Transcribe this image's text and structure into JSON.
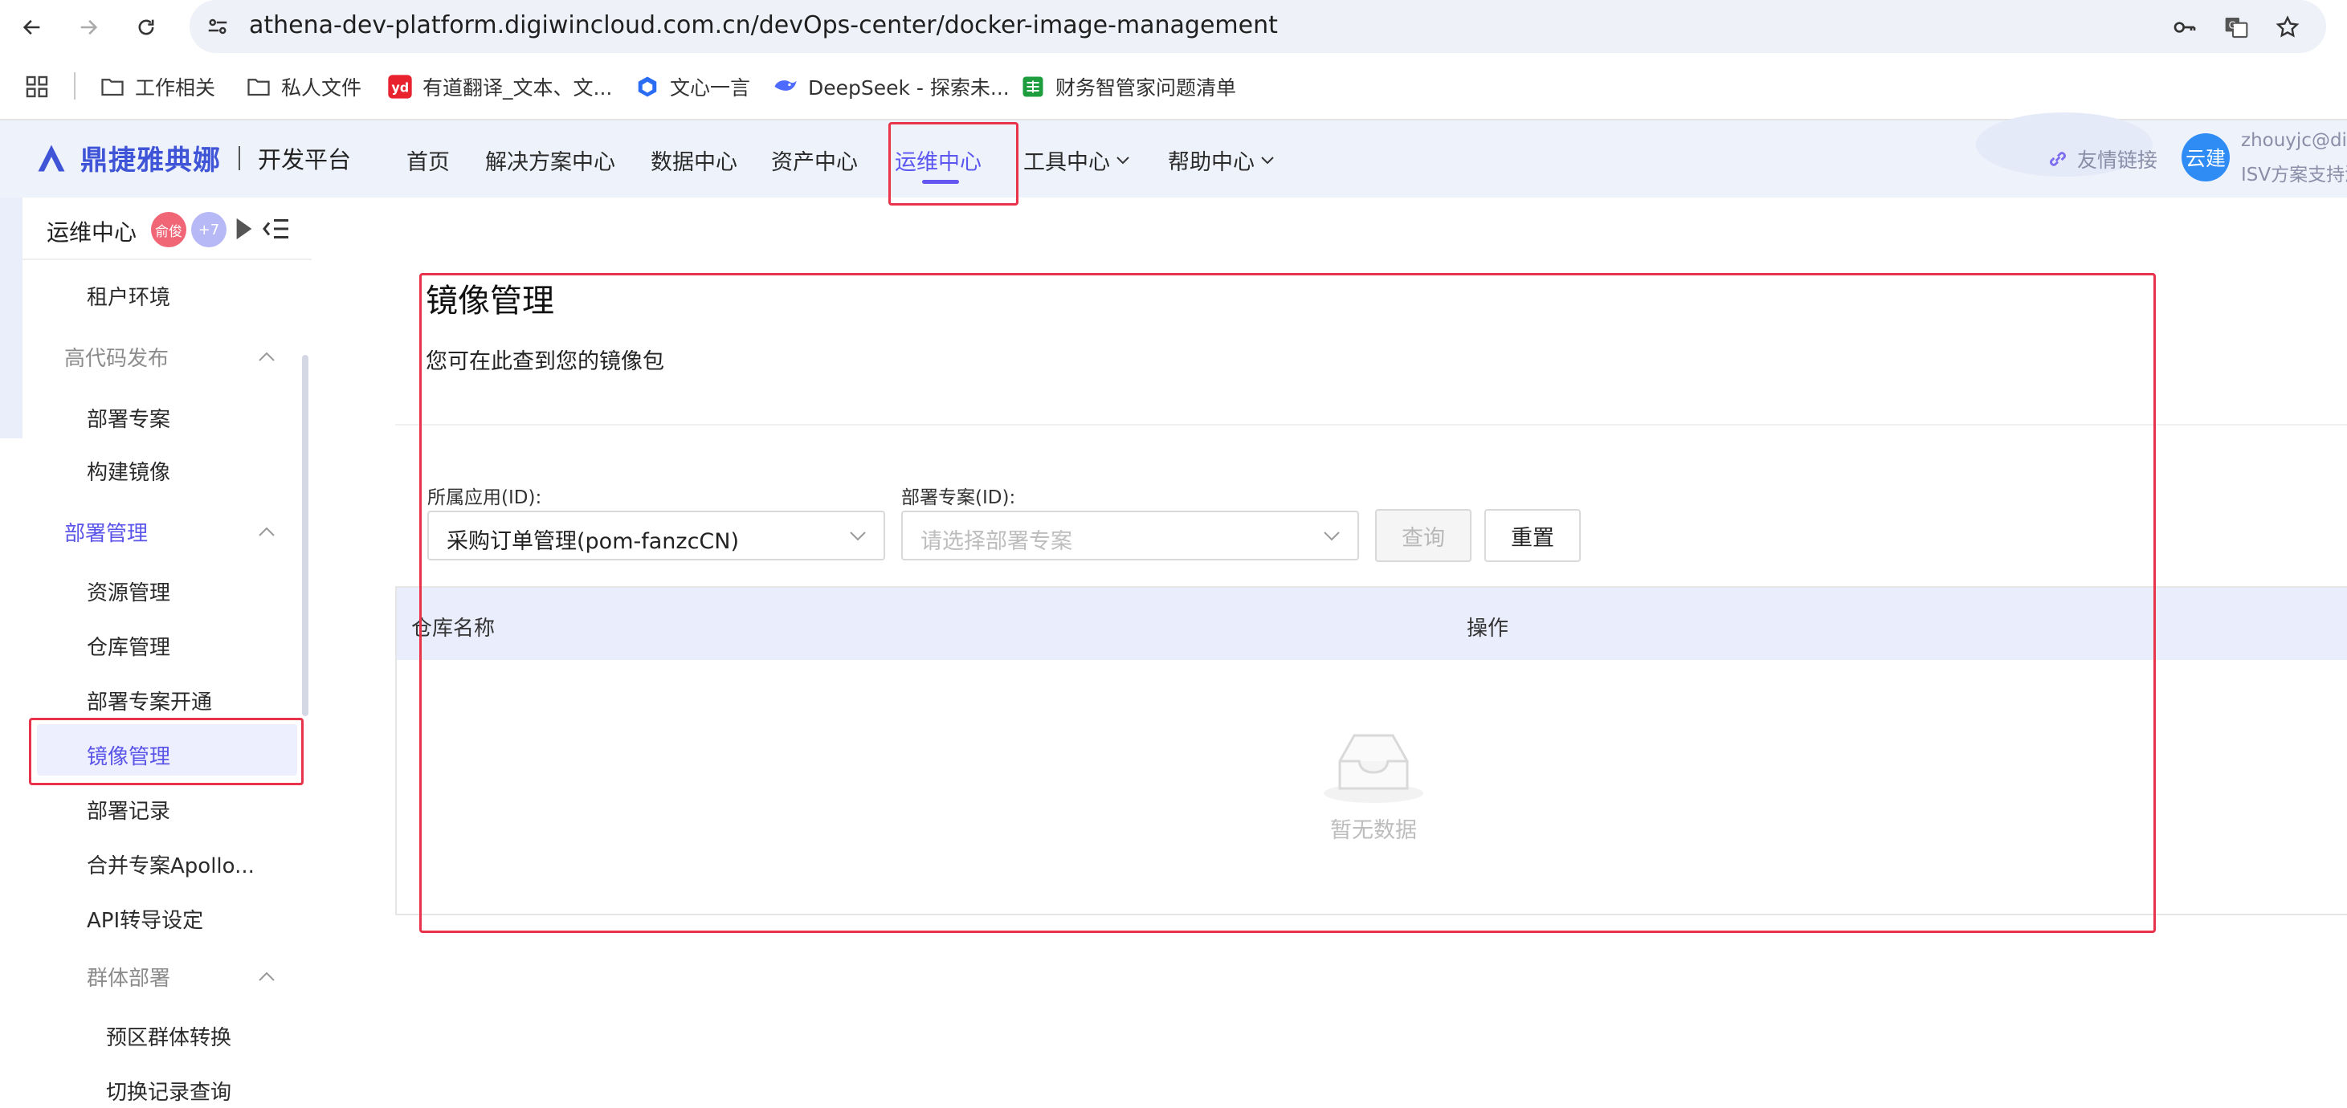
{
  "browser": {
    "url": "athena-dev-platform.digiwincloud.com.cn/devOps-center/docker-image-management",
    "bookmarks": [
      {
        "label": "工作相关",
        "icon": "folder-icon"
      },
      {
        "label": "私人文件",
        "icon": "folder-icon"
      },
      {
        "label": "有道翻译_文本、文...",
        "icon": "youdao-icon"
      },
      {
        "label": "文心一言",
        "icon": "wenxin-icon"
      },
      {
        "label": "DeepSeek - 探索未...",
        "icon": "deepseek-icon"
      },
      {
        "label": "财务智管家问题清单",
        "icon": "sheet-icon"
      }
    ]
  },
  "header": {
    "brand": "鼎捷雅典娜",
    "subtitle": "开发平台",
    "nav": [
      {
        "label": "首页"
      },
      {
        "label": "解决方案中心"
      },
      {
        "label": "数据中心"
      },
      {
        "label": "资产中心"
      },
      {
        "label": "运维中心",
        "active": true
      },
      {
        "label": "工具中心",
        "dropdown": true
      },
      {
        "label": "帮助中心",
        "dropdown": true
      }
    ],
    "friend_link": "友情链接",
    "avatar_text": "云建",
    "user_email": "zhouyjc@dig",
    "user_role": "ISV方案支持测"
  },
  "sidebar": {
    "title": "运维中心",
    "badge_user": "俞俊",
    "badge_more": "+7",
    "items": [
      {
        "label": "租户环境",
        "type": "item"
      },
      {
        "label": "高代码发布",
        "type": "group"
      },
      {
        "label": "部署专案",
        "type": "item"
      },
      {
        "label": "构建镜像",
        "type": "item"
      },
      {
        "label": "部署管理",
        "type": "group",
        "active": true
      },
      {
        "label": "资源管理",
        "type": "item"
      },
      {
        "label": "仓库管理",
        "type": "item"
      },
      {
        "label": "部署专案开通",
        "type": "item"
      },
      {
        "label": "镜像管理",
        "type": "item",
        "selected": true
      },
      {
        "label": "部署记录",
        "type": "item"
      },
      {
        "label": "合并专案Apollo...",
        "type": "item"
      },
      {
        "label": "API转导设定",
        "type": "item"
      },
      {
        "label": "群体部署",
        "type": "group"
      },
      {
        "label": "预区群体转换",
        "type": "item"
      },
      {
        "label": "切换记录查询",
        "type": "item"
      }
    ]
  },
  "main": {
    "title": "镜像管理",
    "description": "您可在此查到您的镜像包",
    "filters": {
      "app_label": "所属应用(ID):",
      "app_value": "采购订单管理(pom-fanzcCN)",
      "project_label": "部署专案(ID):",
      "project_placeholder": "请选择部署专案"
    },
    "buttons": {
      "query": "查询",
      "reset": "重置"
    },
    "table": {
      "columns": [
        "仓库名称",
        "操作"
      ],
      "empty_text": "暂无数据"
    }
  },
  "colors": {
    "accent": "#5b56f0",
    "annotation": "#e8334a",
    "brand": "#3f54d6"
  }
}
